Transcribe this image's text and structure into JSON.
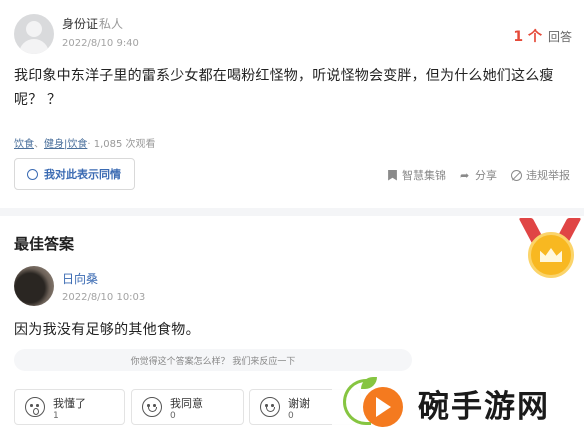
{
  "question": {
    "asker_name": "身份证",
    "asker_private": "私人",
    "time": "2022/8/10 9:40",
    "answer_count": "1 个",
    "answer_count_label": "回答",
    "text": "我印象中东洋子里的雷系少女都在喝粉红怪物，听说怪物会变胖，但为什么她们这么瘦呢？ ？",
    "tag_1": "饮食",
    "tag_sep": "、",
    "tag_2": "健身|饮食",
    "views": "· 1,085 次观看",
    "sympathy_label": "我对此表示同情",
    "actions": {
      "collect": "智慧集锦",
      "share": "分享",
      "report": "违规举报"
    }
  },
  "best_answer": {
    "title": "最佳答案",
    "answerer_name": "日向桑",
    "time": "2022/8/10 10:03",
    "text": "因为我没有足够的其他食物。",
    "feedback_prompt": "你觉得这个答案怎么样？ 我们来反应一下",
    "reactions": [
      {
        "label": "我懂了",
        "count": "1"
      },
      {
        "label": "我同意",
        "count": "0"
      },
      {
        "label": "谢谢",
        "count": "0"
      }
    ]
  },
  "watermark": {
    "text": "碗手游网"
  },
  "colors": {
    "accent_red": "#e54a39",
    "link_blue": "#3b6bb3",
    "medal_gold": "#f8b821",
    "logo_orange": "#f47a1f",
    "logo_green": "#86c541"
  }
}
